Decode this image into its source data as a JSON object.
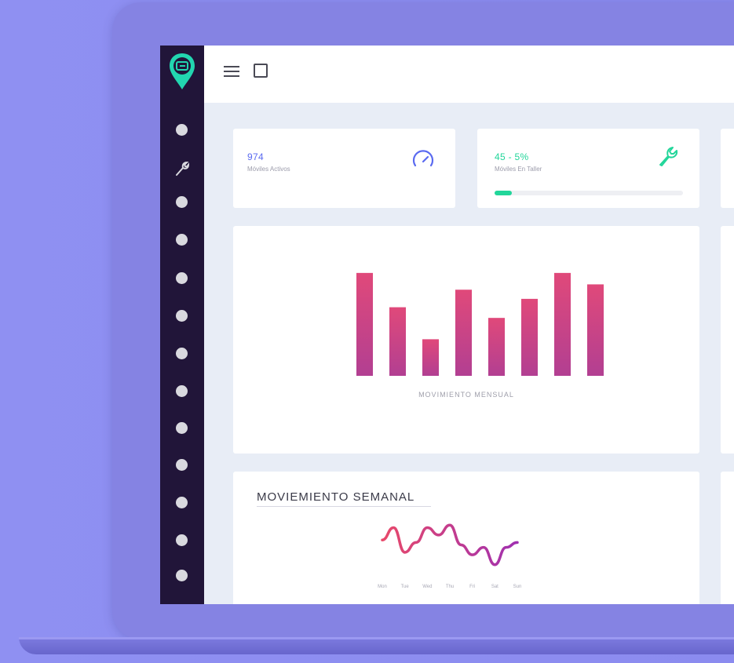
{
  "colors": {
    "background": "#8e8cf0",
    "sidebar": "#211539",
    "accent_teal": "#22d69a",
    "accent_blue": "#5a6af0",
    "bar_gradient_top": "#e0497a",
    "bar_gradient_bottom": "#b23f92",
    "line_gradient_start": "#e8496a",
    "line_gradient_end": "#a030b0"
  },
  "left_fragments": [
    ".",
    ".",
    "n"
  ],
  "topbar": {
    "menu_icon": "hamburger-menu-icon",
    "window_icon": "square-window-icon"
  },
  "sidebar": {
    "logo_icon": "location-pin-logo-icon",
    "items": [
      {
        "icon": "dot-icon"
      },
      {
        "icon": "wrench-icon"
      },
      {
        "icon": "dot-icon"
      },
      {
        "icon": "dot-icon"
      },
      {
        "icon": "dot-icon"
      },
      {
        "icon": "dot-icon"
      },
      {
        "icon": "dot-icon"
      },
      {
        "icon": "dot-icon"
      },
      {
        "icon": "dot-icon"
      },
      {
        "icon": "dot-icon"
      },
      {
        "icon": "dot-icon"
      },
      {
        "icon": "dot-icon"
      },
      {
        "icon": "dot-icon"
      }
    ]
  },
  "stats": [
    {
      "value": "974",
      "label": "Móviles Activos",
      "icon": "speedometer-icon",
      "color": "#5a6af0"
    },
    {
      "value": "45 - 5%",
      "label": "Móviles En Taller",
      "icon": "wrench-icon",
      "color": "#22d69a",
      "progress": 0.05
    }
  ],
  "chart_data": [
    {
      "type": "bar",
      "title": "MOVIMIENTO MENSUAL",
      "values": [
        135,
        90,
        48,
        113,
        76,
        101,
        135,
        120
      ],
      "ylim": [
        0,
        140
      ]
    },
    {
      "type": "line",
      "title": "MOVIEMIENTO SEMANAL",
      "categories": [
        "Mon",
        "Tue",
        "Wed",
        "Thu",
        "Fri",
        "Sat",
        "Sun"
      ],
      "x": [
        0,
        0.5,
        1,
        1.5,
        2,
        2.5,
        3,
        3.5,
        4,
        4.5,
        5,
        5.5,
        6
      ],
      "values": [
        0.6,
        0.85,
        0.35,
        0.55,
        0.85,
        0.7,
        0.9,
        0.5,
        0.3,
        0.45,
        0.1,
        0.45,
        0.55
      ],
      "ylim": [
        0,
        1
      ]
    }
  ]
}
